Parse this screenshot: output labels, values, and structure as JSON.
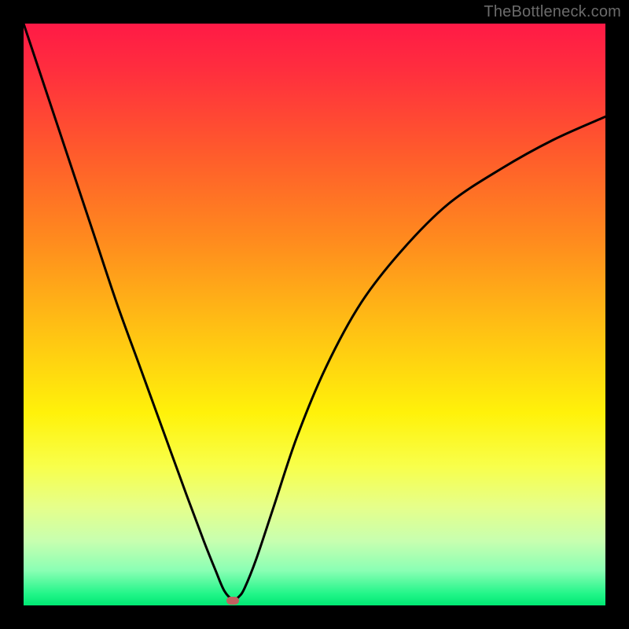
{
  "watermark": "TheBottleneck.com",
  "chart_data": {
    "type": "line",
    "title": "",
    "xlabel": "",
    "ylabel": "",
    "xlim": [
      0,
      100
    ],
    "ylim": [
      0,
      100
    ],
    "curve": {
      "x": [
        0,
        2,
        5,
        8,
        12,
        16,
        20,
        24,
        28,
        31,
        33,
        34.5,
        36,
        37,
        38,
        40,
        43,
        47,
        52,
        58,
        65,
        73,
        82,
        91,
        100
      ],
      "y": [
        100,
        94,
        85,
        76,
        64,
        52,
        41,
        30,
        19,
        11,
        6,
        2.5,
        1,
        1.5,
        3,
        8,
        17,
        29,
        41,
        52,
        61,
        69,
        75,
        80,
        84
      ]
    },
    "min_point": {
      "x": 36,
      "y": 0.8
    },
    "colors": {
      "gradient_top": "#ff1a46",
      "gradient_bottom": "#00e873",
      "curve": "#000000",
      "marker": "#c16060",
      "frame": "#000000"
    }
  }
}
